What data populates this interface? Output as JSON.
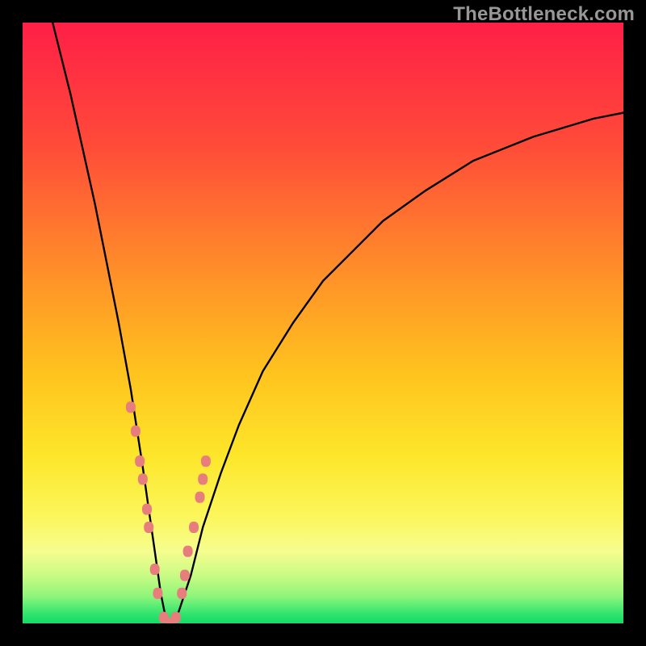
{
  "watermark": "TheBottleneck.com",
  "chart_data": {
    "type": "line",
    "title": "",
    "xlabel": "",
    "ylabel": "",
    "xlim": [
      0,
      100
    ],
    "ylim": [
      0,
      100
    ],
    "series": [
      {
        "name": "bottleneck-curve",
        "x": [
          5,
          8,
          10,
          12,
          14,
          16,
          18,
          20,
          21,
          22,
          23,
          24,
          25,
          26,
          28,
          30,
          33,
          36,
          40,
          45,
          50,
          55,
          60,
          67,
          75,
          85,
          95,
          100
        ],
        "y": [
          100,
          88,
          79,
          70,
          60,
          50,
          39,
          26,
          19,
          12,
          5,
          0,
          0,
          2,
          8,
          16,
          25,
          33,
          42,
          50,
          57,
          62,
          67,
          72,
          77,
          81,
          84,
          85
        ]
      }
    ],
    "markers": {
      "name": "highlight-dots",
      "x": [
        18.0,
        18.8,
        19.5,
        20.0,
        20.7,
        21.0,
        22.0,
        22.5,
        23.5,
        24.5,
        25.5,
        26.5,
        27.0,
        27.5,
        28.5,
        29.5,
        30.0,
        30.5
      ],
      "y": [
        36,
        32,
        27,
        24,
        19,
        16,
        9,
        5,
        1,
        0,
        1,
        5,
        8,
        12,
        16,
        21,
        24,
        27
      ]
    },
    "background": {
      "gradient_stops": [
        {
          "pos": 0.0,
          "color": "#ff1f47"
        },
        {
          "pos": 0.2,
          "color": "#ff4a39"
        },
        {
          "pos": 0.4,
          "color": "#ff8a2a"
        },
        {
          "pos": 0.58,
          "color": "#ffc21e"
        },
        {
          "pos": 0.72,
          "color": "#fde62a"
        },
        {
          "pos": 0.82,
          "color": "#fcf65a"
        },
        {
          "pos": 0.88,
          "color": "#f6fd8e"
        },
        {
          "pos": 0.92,
          "color": "#c9fb84"
        },
        {
          "pos": 0.955,
          "color": "#8ef57a"
        },
        {
          "pos": 0.985,
          "color": "#2ee46e"
        },
        {
          "pos": 1.0,
          "color": "#18d867"
        }
      ]
    }
  }
}
